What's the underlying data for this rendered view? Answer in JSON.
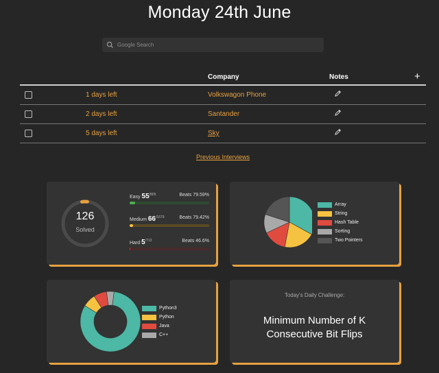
{
  "header": {
    "title": "Monday 24th June"
  },
  "search": {
    "placeholder": "Google Search"
  },
  "table": {
    "col_company": "Company",
    "col_notes": "Notes",
    "add_label": "+",
    "rows": [
      {
        "days": "1 days left",
        "company": "Volkswagon Phone",
        "linked": false
      },
      {
        "days": "2 days left",
        "company": "Santander",
        "linked": false
      },
      {
        "days": "5 days left",
        "company": "Sky",
        "linked": true
      }
    ]
  },
  "previous_link": "Previous Interviews",
  "colors": {
    "accent": "#e7a13f",
    "easy": "#4cae4c",
    "medium": "#f5c242",
    "hard": "#c0392b",
    "teal": "#4cb8a5",
    "yellow": "#f5c242",
    "red": "#e04b40",
    "grey": "#a9a9a9",
    "dark": "#555555"
  },
  "stats": {
    "solved_count": "126",
    "solved_label": "Solved",
    "solved_fraction": 0.039,
    "easy": {
      "label": "Easy",
      "solved": "55",
      "total": "/805",
      "beats": "Beats 79.59%",
      "fraction": 0.068
    },
    "medium": {
      "label": "Medium",
      "solved": "66",
      "total": "/1679",
      "beats": "Beats 79.42%",
      "fraction": 0.039
    },
    "hard": {
      "label": "Hard",
      "solved": "5",
      "total": "/713",
      "beats": "Beats 46.6%",
      "fraction": 0.007
    }
  },
  "topics": {
    "items": [
      {
        "label": "Array",
        "color": "teal",
        "share": 0.33
      },
      {
        "label": "String",
        "color": "yellow",
        "share": 0.2
      },
      {
        "label": "Hash Table",
        "color": "red",
        "share": 0.15
      },
      {
        "label": "Sorting",
        "color": "grey",
        "share": 0.12
      },
      {
        "label": "Two Pointers",
        "color": "dark",
        "share": 0.2
      }
    ]
  },
  "languages": {
    "items": [
      {
        "label": "Python3",
        "color": "teal",
        "share": 0.82
      },
      {
        "label": "Python",
        "color": "yellow",
        "share": 0.07
      },
      {
        "label": "Java",
        "color": "red",
        "share": 0.07
      },
      {
        "label": "C++",
        "color": "grey",
        "share": 0.04
      }
    ]
  },
  "challenge": {
    "label": "Today's Daily Challenge:",
    "title": "Minimum Number of K Consecutive Bit Flips"
  }
}
